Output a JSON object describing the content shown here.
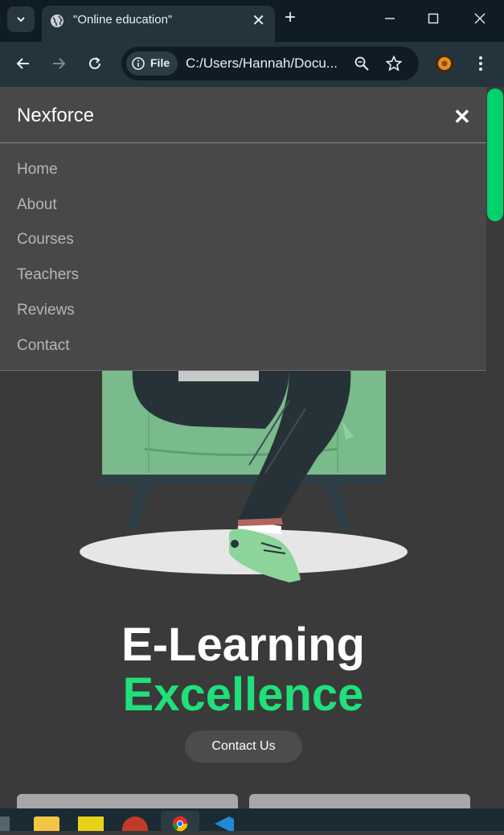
{
  "browser": {
    "tab_title": "\"Online education\"",
    "tab_close": "✕",
    "new_tab": "+",
    "url_chip": "File",
    "url": "C:/Users/Hannah/Docu..."
  },
  "menu": {
    "brand": "Nexforce",
    "close": "✕",
    "items": [
      "Home",
      "About",
      "Courses",
      "Teachers",
      "Reviews",
      "Contact"
    ]
  },
  "hero": {
    "title_line1": "E-Learning",
    "title_line2": "Excellence",
    "cta": "Contact Us"
  },
  "colors": {
    "accent": "#1fe07a",
    "page_bg": "#3a3a3a",
    "menu_bg": "#484848"
  },
  "icons": [
    "chevron-down-icon",
    "globe-icon",
    "close-icon",
    "plus-icon",
    "minimize-icon",
    "maximize-icon",
    "back-icon",
    "forward-icon",
    "reload-icon",
    "info-icon",
    "zoom-icon",
    "star-icon",
    "profile-avatar",
    "more-icon"
  ]
}
